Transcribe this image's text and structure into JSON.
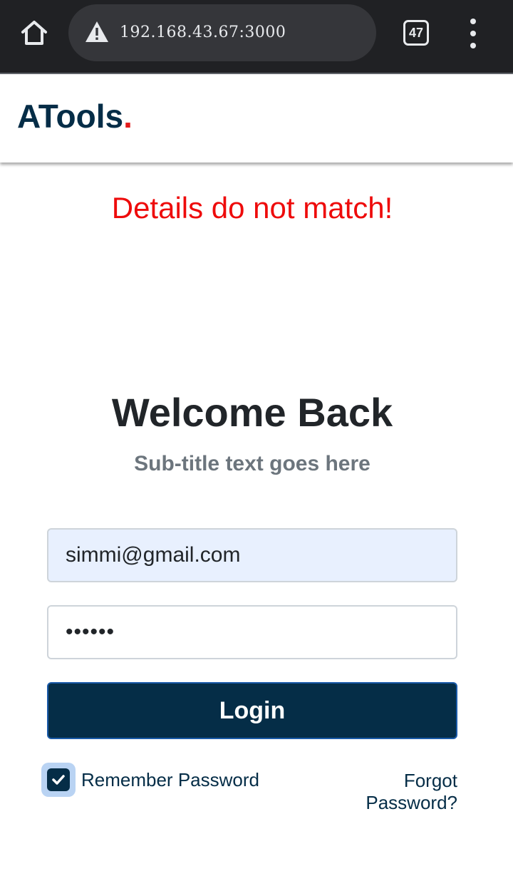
{
  "browser": {
    "url": "192.168.43.67:3000",
    "tab_count": "47"
  },
  "header": {
    "brand_text": "ATools",
    "brand_dot": "."
  },
  "alert": {
    "error_message": "Details do not match!"
  },
  "login_form": {
    "title": "Welcome Back",
    "subtitle": "Sub-title text goes here",
    "email_value": "simmi@gmail.com",
    "password_mask": "••••••",
    "login_label": "Login",
    "remember_label": "Remember Password",
    "remember_checked": true,
    "forgot_label": "Forgot Password?"
  },
  "colors": {
    "brand": "#052d47",
    "accent_dot": "#e31b1b",
    "error": "#ee0b0b",
    "autofill_bg": "#e8f0fe"
  }
}
